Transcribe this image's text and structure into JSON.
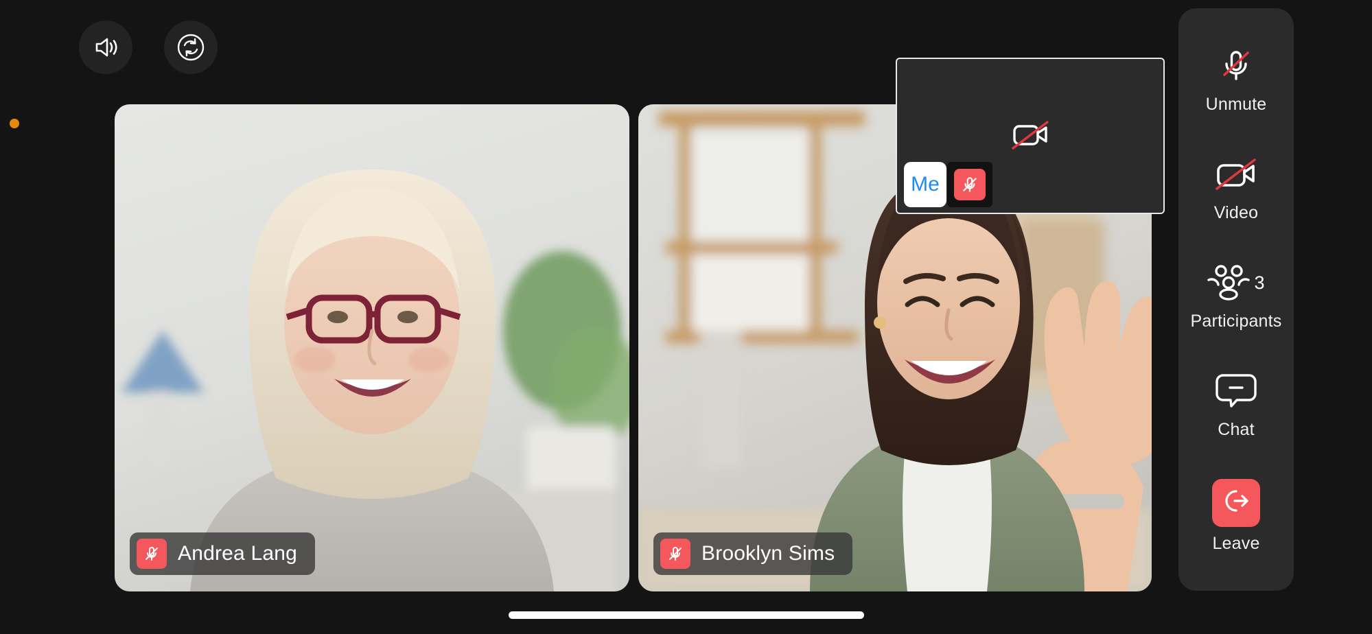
{
  "app": {
    "screen_name": "Video Call",
    "background_color": "#141414",
    "accent_red": "#F4585C",
    "panel_color": "#2B2B2B",
    "me_text_color": "#1D8BF5",
    "status_dot_color": "#E8890C"
  },
  "top_controls": [
    {
      "name": "speaker-icon",
      "label": "Speaker"
    },
    {
      "name": "switch-camera-icon",
      "label": "Switch Camera"
    }
  ],
  "participants_tiles": [
    {
      "name": "Andrea Lang",
      "muted": true,
      "mic_icon": "mic-off-icon"
    },
    {
      "name": "Brooklyn Sims",
      "muted": true,
      "mic_icon": "mic-off-icon"
    }
  ],
  "self_view": {
    "label": "Me",
    "muted": true,
    "video_off": true,
    "video_icon": "video-off-icon",
    "mic_icon": "mic-off-icon"
  },
  "sidebar": {
    "items": [
      {
        "label": "Unmute",
        "icon": "mic-off-icon",
        "count": ""
      },
      {
        "label": "Video",
        "icon": "video-off-icon",
        "count": ""
      },
      {
        "label": "Participants",
        "icon": "participants-icon",
        "count": "3"
      },
      {
        "label": "Chat",
        "icon": "chat-bubble-icon",
        "count": ""
      },
      {
        "label": "Leave",
        "icon": "leave-arrow-icon",
        "count": ""
      }
    ]
  },
  "system": {
    "home_indicator": true
  }
}
